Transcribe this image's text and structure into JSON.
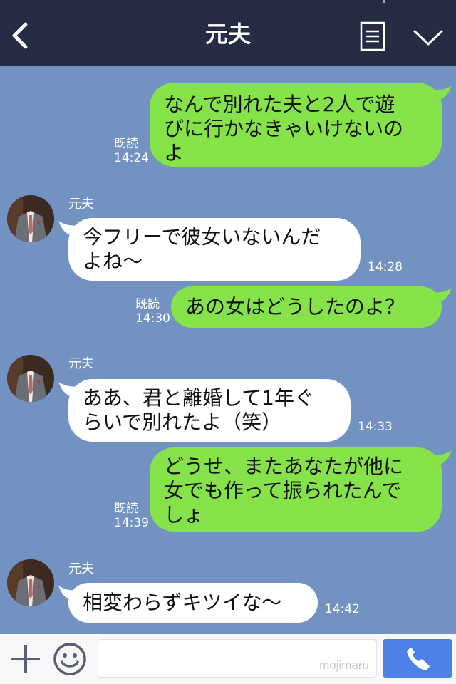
{
  "header": {
    "title": "元夫",
    "icons": [
      "back-icon",
      "memo-icon",
      "chevron-down-icon"
    ]
  },
  "messages": [
    {
      "side": "right",
      "text": "なんで別れた夫と2人で遊\nびに行かなきゃいけないの\nよ",
      "read": "既読",
      "time": "14:24"
    },
    {
      "side": "left",
      "sender": "元夫",
      "text": "今フリーで彼女いないんだ\nよね〜",
      "time": "14:28"
    },
    {
      "side": "right",
      "text": "あの女はどうしたのよ？",
      "read": "既読",
      "time": "14:30"
    },
    {
      "side": "left",
      "sender": "元夫",
      "text": "ああ、君と離婚して1年ぐ\nらいで別れたよ（笑）",
      "time": "14:33"
    },
    {
      "side": "right",
      "text": "どうせ、またあなたが他に\n女でも作って振られたんで\nしょ",
      "read": "既読",
      "time": "14:39"
    },
    {
      "side": "left",
      "sender": "元夫",
      "text": "相変わらずキツイな〜",
      "time": "14:42"
    }
  ],
  "footer": {
    "placeholder": "mojimaru",
    "icons": [
      "plus-icon",
      "emoji-icon",
      "phone-icon"
    ]
  },
  "colors": {
    "header": "#252c44",
    "background": "#7292c1",
    "green_bubble": "#85e249",
    "white_bubble": "#ffffff",
    "call_button": "#4e81e6"
  }
}
